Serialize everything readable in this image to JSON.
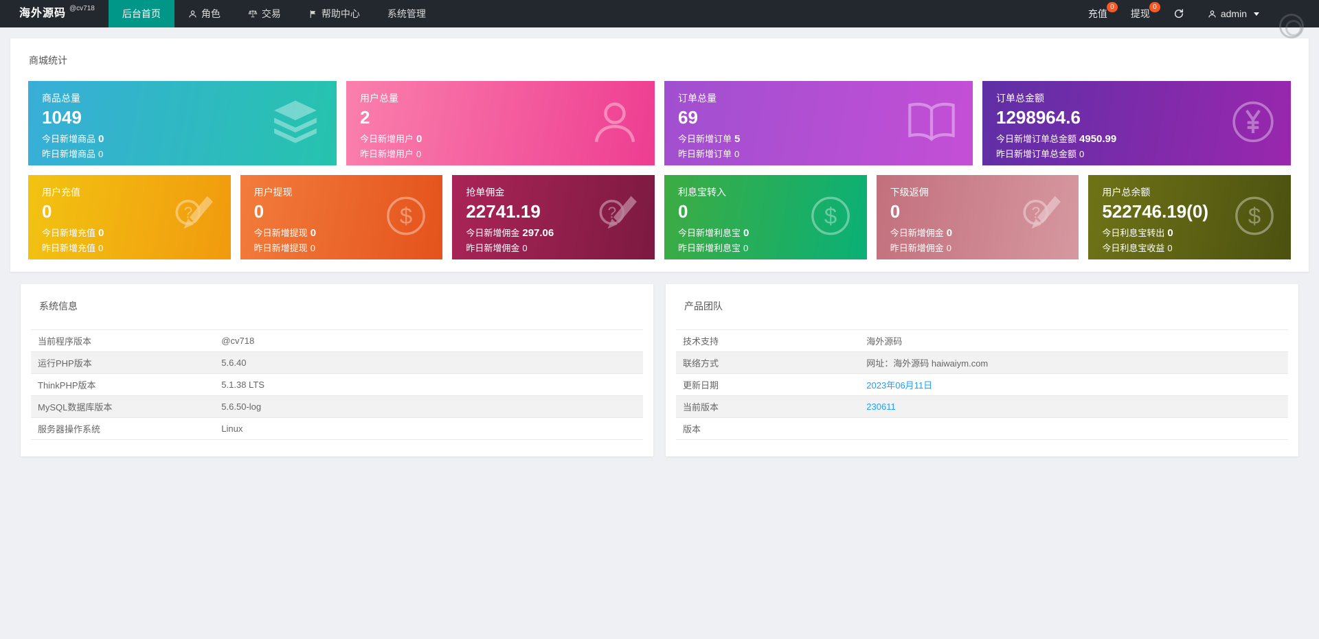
{
  "navbar": {
    "brand": "海外源码",
    "brand_sup": "@cv718",
    "menu": [
      {
        "key": "home",
        "label": "后台首页",
        "active": true
      },
      {
        "key": "roles",
        "label": "角色",
        "icon": "person-icon"
      },
      {
        "key": "trade",
        "label": "交易",
        "icon": "scales-icon"
      },
      {
        "key": "help",
        "label": "帮助中心",
        "icon": "flag-icon"
      },
      {
        "key": "system",
        "label": "系统管理"
      }
    ],
    "recharge": {
      "label": "充值",
      "badge": "0"
    },
    "withdraw": {
      "label": "提现",
      "badge": "0"
    },
    "user": {
      "name": "admin"
    }
  },
  "stats": {
    "title": "商城统计",
    "row1": [
      {
        "title": "商品总量",
        "value": "1049",
        "sub1_label": "今日新增商品",
        "sub1_value": "0",
        "sub2_label": "昨日新增商品",
        "sub2_value": "0",
        "icon": "layers-icon",
        "gradient": [
          "#38aed8",
          "#26c3ad"
        ]
      },
      {
        "title": "用户总量",
        "value": "2",
        "sub1_label": "今日新增用户",
        "sub1_value": "0",
        "sub2_label": "昨日新增用户",
        "sub2_value": "0",
        "icon": "user-outline-icon",
        "gradient": [
          "#fa80ac",
          "#ee3d92"
        ]
      },
      {
        "title": "订单总量",
        "value": "69",
        "sub1_label": "今日新增订单",
        "sub1_value": "5",
        "sub2_label": "昨日新增订单",
        "sub2_value": "0",
        "icon": "book-icon",
        "gradient": [
          "#a04fd0",
          "#c44fd6"
        ]
      },
      {
        "title": "订单总金额",
        "value": "1298964.6",
        "sub1_label": "今日新增订单总金额",
        "sub1_value": "4950.99",
        "sub2_label": "昨日新增订单总金额",
        "sub2_value": "0",
        "icon": "yen-circle-icon",
        "gradient": [
          "#5e2fa6",
          "#9a27ae"
        ]
      }
    ],
    "row2": [
      {
        "title": "用户充值",
        "value": "0",
        "sub1_label": "今日新增充值",
        "sub1_value": "0",
        "sub2_label": "昨日新增充值",
        "sub2_value": "0",
        "icon": "edit-question-icon",
        "gradient": [
          "#f2c312",
          "#f19a0e"
        ]
      },
      {
        "title": "用户提现",
        "value": "0",
        "sub1_label": "今日新增提现",
        "sub1_value": "0",
        "sub2_label": "昨日新增提现",
        "sub2_value": "0",
        "icon": "dollar-circle-icon",
        "gradient": [
          "#f27c3c",
          "#e4531c"
        ]
      },
      {
        "title": "抢单佣金",
        "value": "22741.19",
        "sub1_label": "今日新增佣金",
        "sub1_value": "297.06",
        "sub2_label": "昨日新增佣金",
        "sub2_value": "0",
        "icon": "edit-question-icon",
        "gradient": [
          "#aa2458",
          "#7c1a41"
        ]
      },
      {
        "title": "利息宝转入",
        "value": "0",
        "sub1_label": "今日新增利息宝",
        "sub1_value": "0",
        "sub2_label": "昨日新增利息宝",
        "sub2_value": "0",
        "icon": "dollar-circle-icon",
        "gradient": [
          "#3dac42",
          "#0ab077"
        ]
      },
      {
        "title": "下级返佣",
        "value": "0",
        "sub1_label": "今日新增佣金",
        "sub1_value": "0",
        "sub2_label": "昨日新增佣金",
        "sub2_value": "0",
        "icon": "edit-question-icon",
        "gradient": [
          "#c2707c",
          "#d698a0"
        ]
      },
      {
        "title": "用户总余额",
        "value": "522746.19(0)",
        "sub1_label": "今日利息宝转出",
        "sub1_value": "0",
        "sub2_label": "今日利息宝收益",
        "sub2_value": "0",
        "icon": "dollar-circle-icon",
        "gradient": [
          "#6f7317",
          "#4c5110"
        ]
      }
    ]
  },
  "system_info": {
    "title": "系统信息",
    "rows": [
      {
        "label": "当前程序版本",
        "value": "@cv718"
      },
      {
        "label": "运行PHP版本",
        "value": "5.6.40"
      },
      {
        "label": "ThinkPHP版本",
        "value": "5.1.38 LTS"
      },
      {
        "label": "MySQL数据库版本",
        "value": "5.6.50-log"
      },
      {
        "label": "服务器操作系统",
        "value": "Linux"
      }
    ]
  },
  "product_team": {
    "title": "产品团队",
    "rows": [
      {
        "label": "技术支持",
        "value": "海外源码"
      },
      {
        "label": "联络方式",
        "value": "网址：海外源码 haiwaiym.com"
      },
      {
        "label": "更新日期",
        "value": "2023年06月11日",
        "link": true
      },
      {
        "label": "当前版本",
        "value": "230611",
        "link": true
      },
      {
        "label": "版本",
        "value": ""
      }
    ]
  }
}
